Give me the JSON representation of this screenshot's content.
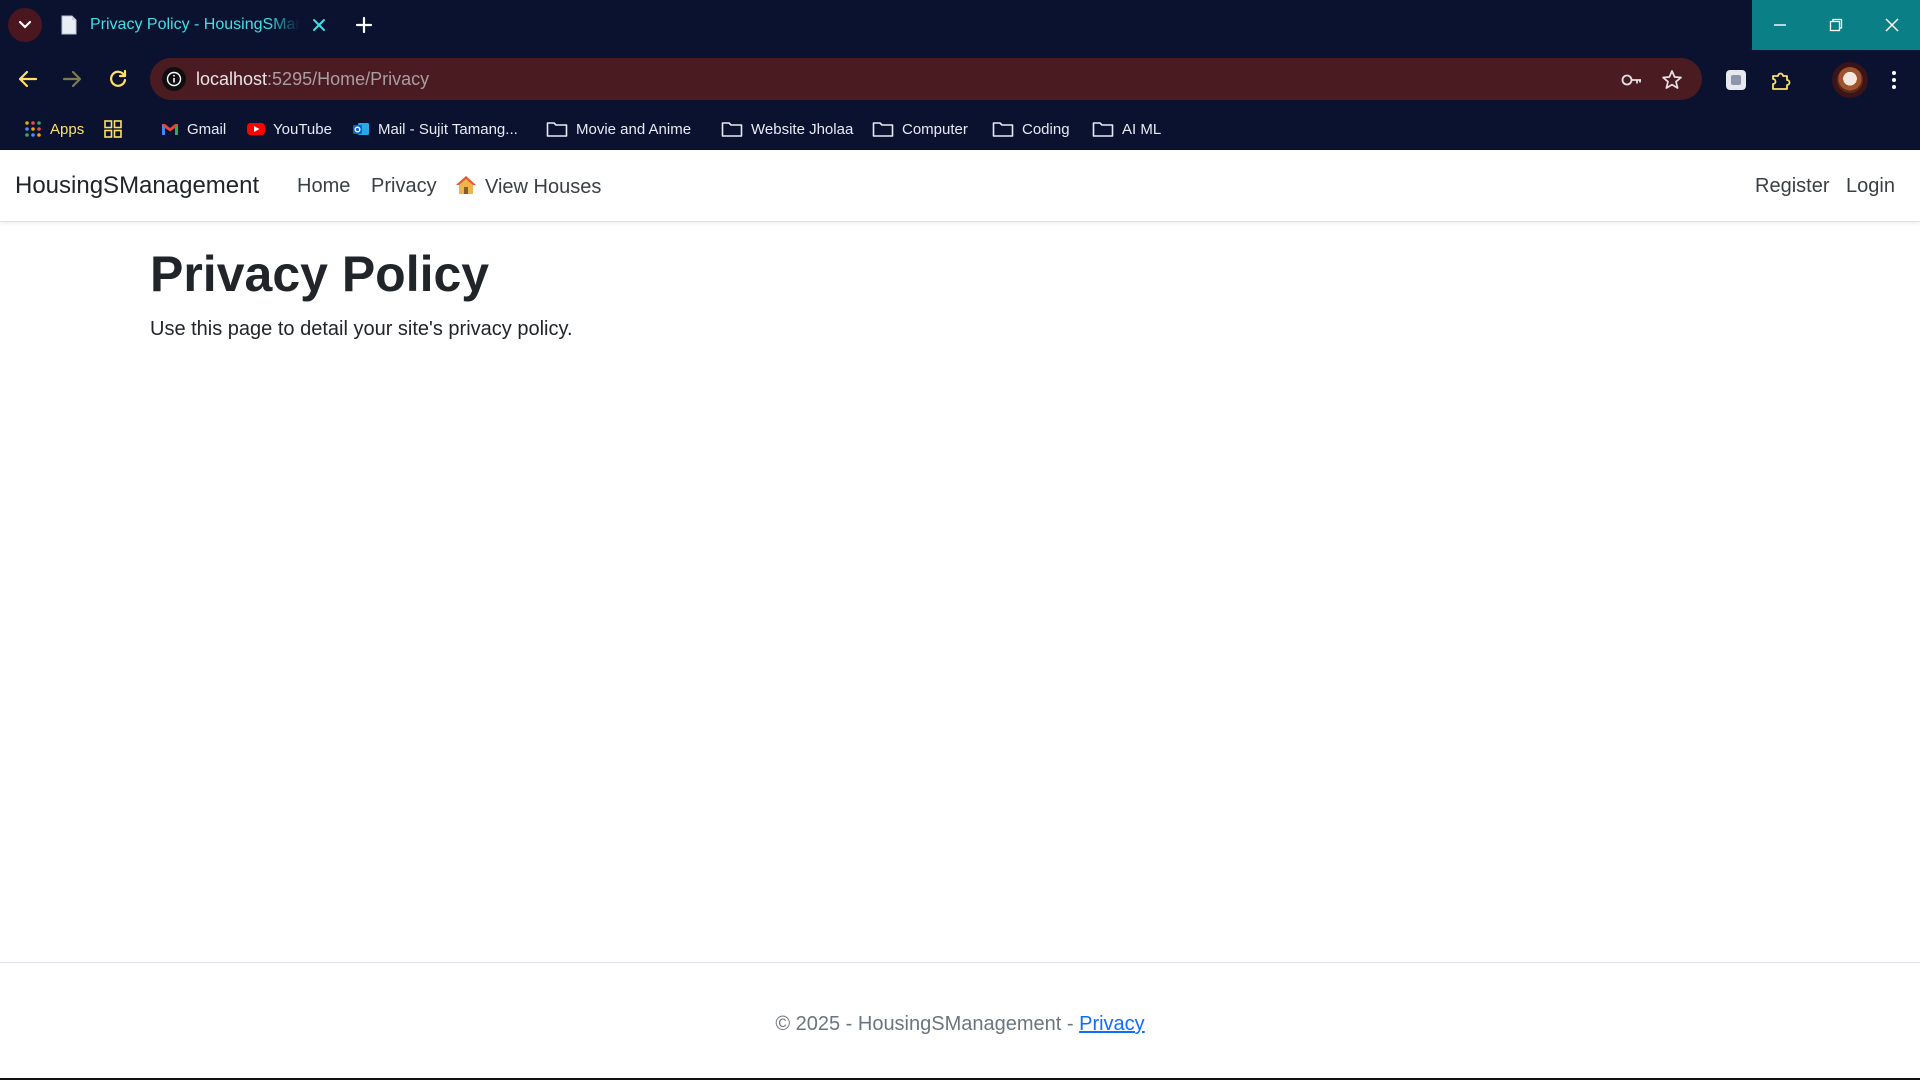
{
  "browser": {
    "tab": {
      "title": "Privacy Policy - HousingSManagement"
    },
    "address": {
      "host": "localhost",
      "rest": ":5295/Home/Privacy"
    },
    "bookmarks": [
      {
        "label": "Apps",
        "icon": "apps-grid-icon"
      },
      {
        "label": "",
        "icon": "grid-icon"
      },
      {
        "label": "Gmail",
        "icon": "gmail-icon"
      },
      {
        "label": "YouTube",
        "icon": "youtube-icon"
      },
      {
        "label": "Mail - Sujit Tamang...",
        "icon": "outlook-icon"
      },
      {
        "label": "Movie and Anime",
        "icon": "folder-icon"
      },
      {
        "label": "Website Jholaa",
        "icon": "folder-icon"
      },
      {
        "label": "Computer",
        "icon": "folder-icon"
      },
      {
        "label": "Coding",
        "icon": "folder-icon"
      },
      {
        "label": "AI ML",
        "icon": "folder-icon"
      }
    ],
    "colors": {
      "frame": "#0a1230",
      "tab_text": "#3fe0e8",
      "omnibox": "#4a1c22",
      "window_controls": "#0b7f86"
    }
  },
  "site": {
    "brand": "HousingSManagement",
    "nav": {
      "home": "Home",
      "privacy": "Privacy",
      "view_houses": "View Houses",
      "register": "Register",
      "login": "Login"
    }
  },
  "main": {
    "title": "Privacy Policy",
    "description": "Use this page to detail your site's privacy policy."
  },
  "footer": {
    "text": "© 2025 - HousingSManagement - ",
    "privacy_link": "Privacy",
    "link_color": "#0d6efd"
  }
}
